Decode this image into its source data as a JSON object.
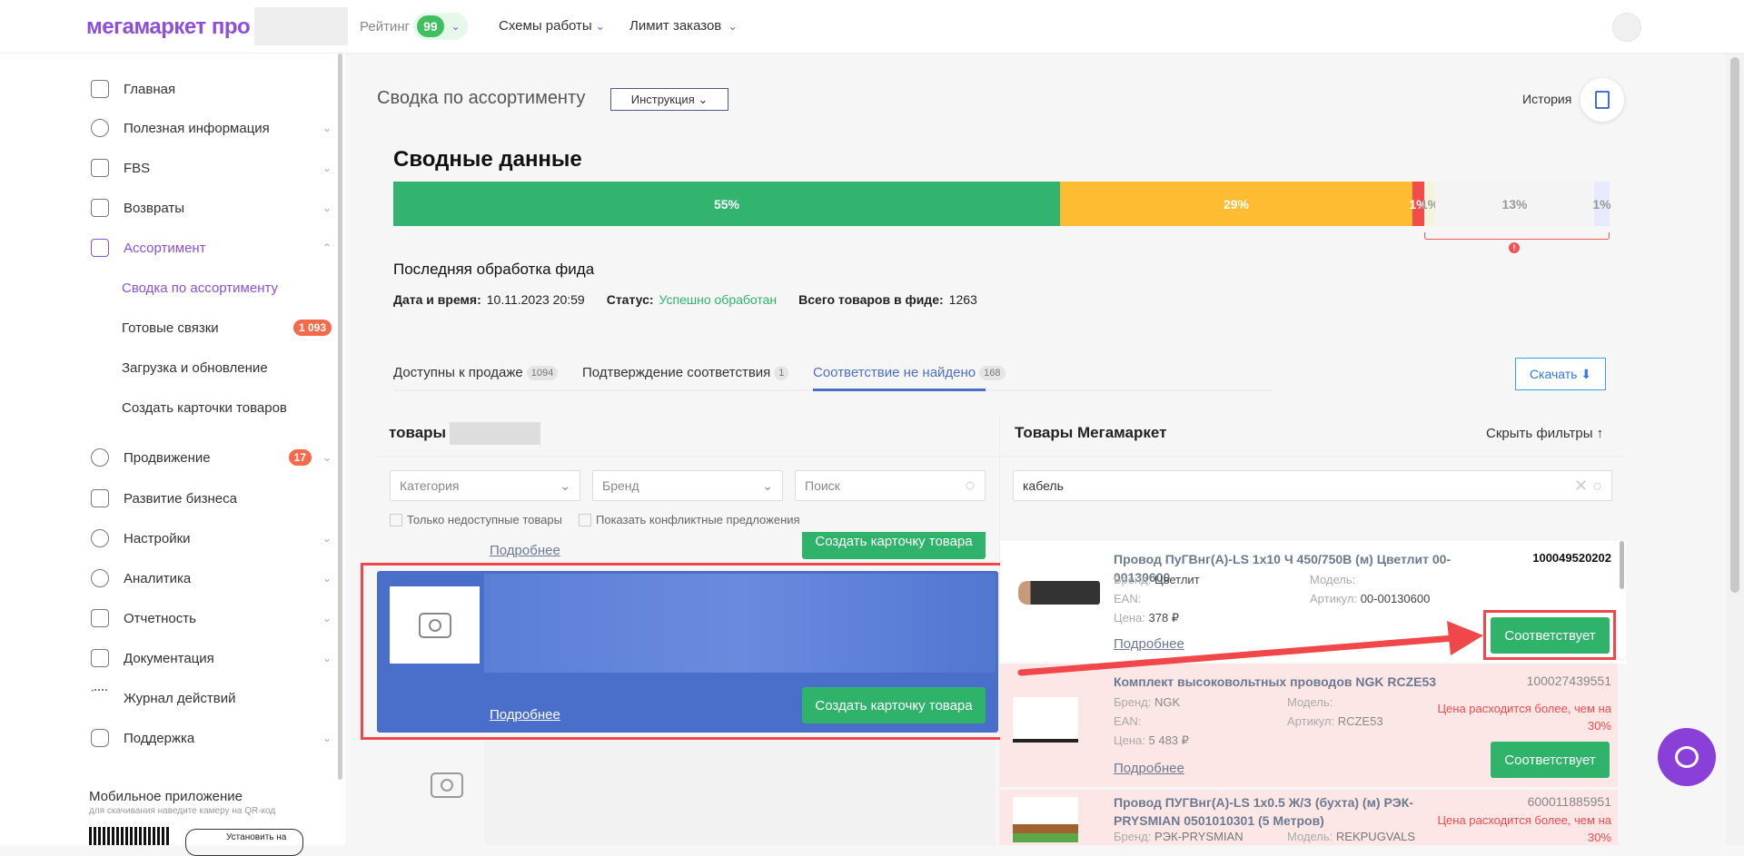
{
  "header": {
    "logo": "мегамаркет про",
    "rating_label": "Рейтинг",
    "rating_value": "99",
    "schemes": "Схемы работы",
    "limit": "Лимит заказов"
  },
  "sidebar": {
    "items": [
      {
        "label": "Главная"
      },
      {
        "label": "Полезная информация"
      },
      {
        "label": "FBS"
      },
      {
        "label": "Возвраты"
      },
      {
        "label": "Ассортимент"
      },
      {
        "label": "Продвижение",
        "badge": "17"
      },
      {
        "label": "Развитие бизнеса"
      },
      {
        "label": "Настройки"
      },
      {
        "label": "Аналитика"
      },
      {
        "label": "Отчетность"
      },
      {
        "label": "Документация"
      },
      {
        "label": "Журнал действий"
      },
      {
        "label": "Поддержка"
      }
    ],
    "subitems": [
      {
        "label": "Сводка по ассортименту"
      },
      {
        "label": "Готовые связки",
        "badge": "1 093"
      },
      {
        "label": "Загрузка и обновление"
      },
      {
        "label": "Создать карточки товаров"
      }
    ],
    "mobile_title": "Мобильное приложение",
    "mobile_sub": "для скачивания наведите камеру на QR-код",
    "install": "Установить на"
  },
  "main": {
    "title": "Сводка по ассортименту",
    "instruction": "Инструкция",
    "history": "История",
    "summary_title": "Сводные данные",
    "bar": [
      {
        "label": "55%",
        "value": 55,
        "color": "#32b36e"
      },
      {
        "label": "29%",
        "value": 29,
        "color": "#fdbc31"
      },
      {
        "label": "1%",
        "value": 1,
        "color": "#f44b4b"
      },
      {
        "label": "1%",
        "value": 1,
        "color": "#f3f6dd"
      },
      {
        "label": "13%",
        "value": 13,
        "color": "#f4f4f4"
      },
      {
        "label": "1%",
        "value": 1,
        "color": "#e6eafa"
      }
    ],
    "feed_title": "Последняя обработка фида",
    "date_label": "Дата и время:",
    "date_value": "10.11.2023 20:59",
    "status_label": "Статус:",
    "status_value": "Успешно обработан",
    "total_label": "Всего товаров в фиде:",
    "total_value": "1263",
    "tabs": [
      {
        "label": "Доступны к продаже",
        "count": "1094"
      },
      {
        "label": "Подтверждение соответствия",
        "count": "1"
      },
      {
        "label": "Соответствие не найдено",
        "count": "168"
      }
    ],
    "download": "Скачать"
  },
  "left": {
    "title": "товары",
    "category": "Категория",
    "brand": "Бренд",
    "search_placeholder": "Поиск",
    "only_unavailable": "Только недоступные товары",
    "show_conflicts": "Показать конфликтные предложения",
    "more": "Подробнее",
    "create": "Создать карточку товара"
  },
  "right": {
    "title": "Товары Мегамаркет",
    "hide_filters": "Скрыть фильтры",
    "search_value": "кабель",
    "brand_label": "Бренд:",
    "ean_label": "EAN:",
    "price_label": "Цена:",
    "model_label": "Модель:",
    "article_label": "Артикул:",
    "more": "Подробнее",
    "match": "Соответствует",
    "products": [
      {
        "title": "Провод ПуГВнг(А)-LS 1x10 Ч 450/750В (м) Цветлит 00-00130600",
        "id": "100049520202",
        "brand": "Цветлит",
        "price": "378 ₽",
        "model": "",
        "article": "00-00130600",
        "warning": ""
      },
      {
        "title": "Комплект высоковольтных проводов NGK RCZE53",
        "id": "100027439551",
        "brand": "NGK",
        "price": "5 483 ₽",
        "model": "",
        "article": "RCZE53",
        "warning": "Цена расходится более, чем на 30%"
      },
      {
        "title": "Провод ПУГВнг(А)-LS 1x0.5 Ж/З (бухта) (м) РЭК-PRYSMIAN 0501010301 (5 Метров)",
        "id": "600011885951",
        "brand": "РЭК-PRYSMIAN",
        "model": "REKPUGVALS",
        "warning": "Цена расходится более, чем на 30%"
      }
    ]
  }
}
